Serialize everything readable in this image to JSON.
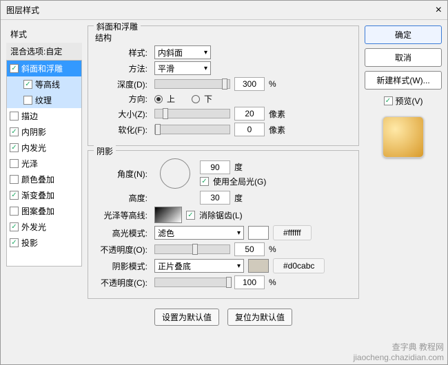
{
  "dialog": {
    "title": "图层样式"
  },
  "left": {
    "heading": "样式",
    "blend": "混合选项:自定",
    "items": [
      {
        "label": "斜面和浮雕",
        "checked": true,
        "selected": true
      },
      {
        "label": "等高线",
        "checked": true,
        "sub": true,
        "highlight": true
      },
      {
        "label": "纹理",
        "checked": false,
        "sub": true,
        "highlight": true
      },
      {
        "label": "描边",
        "checked": false
      },
      {
        "label": "内阴影",
        "checked": true
      },
      {
        "label": "内发光",
        "checked": true
      },
      {
        "label": "光泽",
        "checked": false
      },
      {
        "label": "颜色叠加",
        "checked": false
      },
      {
        "label": "渐变叠加",
        "checked": true
      },
      {
        "label": "图案叠加",
        "checked": false
      },
      {
        "label": "外发光",
        "checked": true
      },
      {
        "label": "投影",
        "checked": true
      }
    ]
  },
  "bevel": {
    "group": "斜面和浮雕",
    "structure": "结构",
    "style_label": "样式:",
    "style_value": "内斜面",
    "method_label": "方法:",
    "method_value": "平滑",
    "depth_label": "深度(D):",
    "depth_value": "300",
    "depth_unit": "%",
    "direction_label": "方向:",
    "up": "上",
    "down": "下",
    "size_label": "大小(Z):",
    "size_value": "20",
    "size_unit": "像素",
    "soften_label": "软化(F):",
    "soften_value": "0",
    "soften_unit": "像素"
  },
  "shading": {
    "group": "阴影",
    "angle_label": "角度(N):",
    "angle_value": "90",
    "angle_unit": "度",
    "global": "使用全局光(G)",
    "alt_label": "高度:",
    "alt_value": "30",
    "alt_unit": "度",
    "gloss_label": "光泽等高线:",
    "aa": "消除锯齿(L)",
    "highlight_mode_label": "高光模式:",
    "highlight_mode_value": "滤色",
    "highlight_hex": "#ffffff",
    "h_opacity_label": "不透明度(O):",
    "h_opacity_value": "50",
    "h_opacity_unit": "%",
    "shadow_mode_label": "阴影模式:",
    "shadow_mode_value": "正片叠底",
    "shadow_hex": "#d0cabc",
    "s_opacity_label": "不透明度(C):",
    "s_opacity_value": "100",
    "s_opacity_unit": "%"
  },
  "buttons": {
    "default": "设置为默认值",
    "reset": "复位为默认值"
  },
  "right": {
    "ok": "确定",
    "cancel": "取消",
    "newstyle": "新建样式(W)...",
    "preview": "预览(V)"
  },
  "watermark": {
    "l1": "查字典 教程网",
    "l2": "jiaocheng.chazidian.com"
  }
}
